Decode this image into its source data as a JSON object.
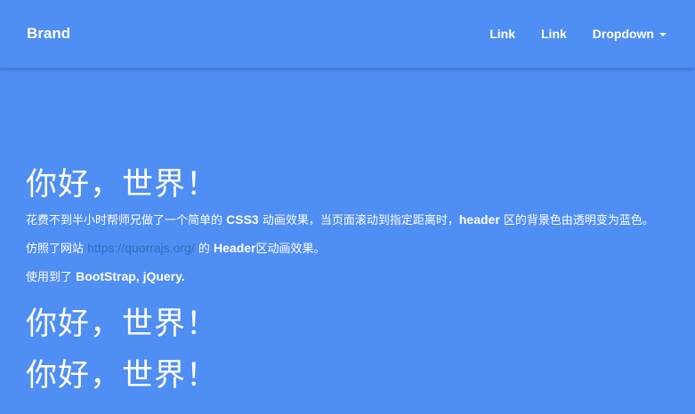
{
  "navbar": {
    "brand": "Brand",
    "links": [
      "Link",
      "Link"
    ],
    "dropdown": "Dropdown"
  },
  "main": {
    "heading1": "你好，世界！",
    "para1_part1": "花费不到半小时帮师兄做了一个简单的 ",
    "para1_bold1": "CSS3",
    "para1_part2": " 动画效果，当页面滚动到指定距离时，",
    "para1_bold2": "header",
    "para1_part3": " 区的背景色由透明变为蓝色。",
    "para2_part1": "仿照了网站 ",
    "para2_link": "https://quorrajs.org/",
    "para2_part2": " 的 ",
    "para2_bold": "Header",
    "para2_part3": "区动画效果。",
    "para3_part1": "使用到了 ",
    "para3_bold": "BootStrap, jQuery.",
    "heading2": "你好，世界！",
    "heading3": "你好，世界！"
  },
  "colors": {
    "background": "#4f8ef3",
    "link": "#2d6dbf",
    "text": "#ffffff"
  }
}
